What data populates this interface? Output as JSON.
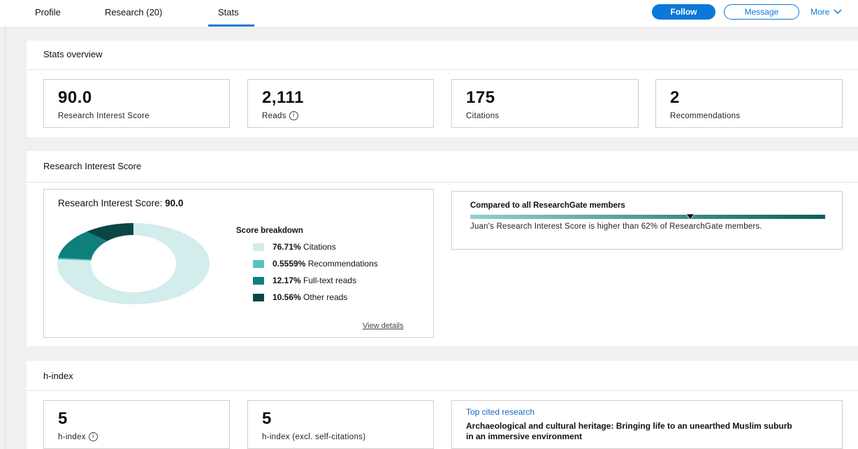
{
  "nav": {
    "tabs": [
      {
        "label": "Profile"
      },
      {
        "label": "Research (20)"
      },
      {
        "label": "Stats"
      }
    ],
    "follow_label": "Follow",
    "message_label": "Message",
    "more_label": "More",
    "accent_color": "#0c78d8"
  },
  "overview": {
    "title": "Stats overview",
    "stats": [
      {
        "value": "90.0",
        "label": "Research Interest Score"
      },
      {
        "value": "2,111",
        "label": "Reads",
        "info_icon": "info-icon"
      },
      {
        "value": "175",
        "label": "Citations"
      },
      {
        "value": "2",
        "label": "Recommendations"
      }
    ]
  },
  "ris": {
    "section_title": "Research Interest Score",
    "card_title": "Research Interest Score:",
    "card_value": "90.0",
    "breakdown_title": "Score breakdown",
    "breakdown": [
      {
        "pct": "76.71%",
        "label": "Citations",
        "value": 76.71,
        "color": "#d3ecec"
      },
      {
        "pct": "0.5559%",
        "label": "Recommendations",
        "value": 0.5559,
        "color": "#5cc0bf"
      },
      {
        "pct": "12.17%",
        "label": "Full-text reads",
        "value": 12.17,
        "color": "#0f7f7c"
      },
      {
        "pct": "10.56%",
        "label": "Other reads",
        "value": 10.56,
        "color": "#0b4646"
      }
    ],
    "view_details": "View details",
    "compare_title": "Compared to all ResearchGate members",
    "compare_text": "Juan's Research Interest Score is higher than 62% of ResearchGate members.",
    "percentile": 62
  },
  "hindex": {
    "section_title": "h-index",
    "boxes": [
      {
        "value": "5",
        "label": "h-index",
        "info_icon": "info-icon"
      },
      {
        "value": "5",
        "label": "h-index (excl. self-citations)"
      }
    ],
    "top_cited_label": "Top cited research",
    "top_cited_title": "Archaeological and cultural heritage: Bringing life to an unearthed Muslim suburb in an immersive environment"
  }
}
